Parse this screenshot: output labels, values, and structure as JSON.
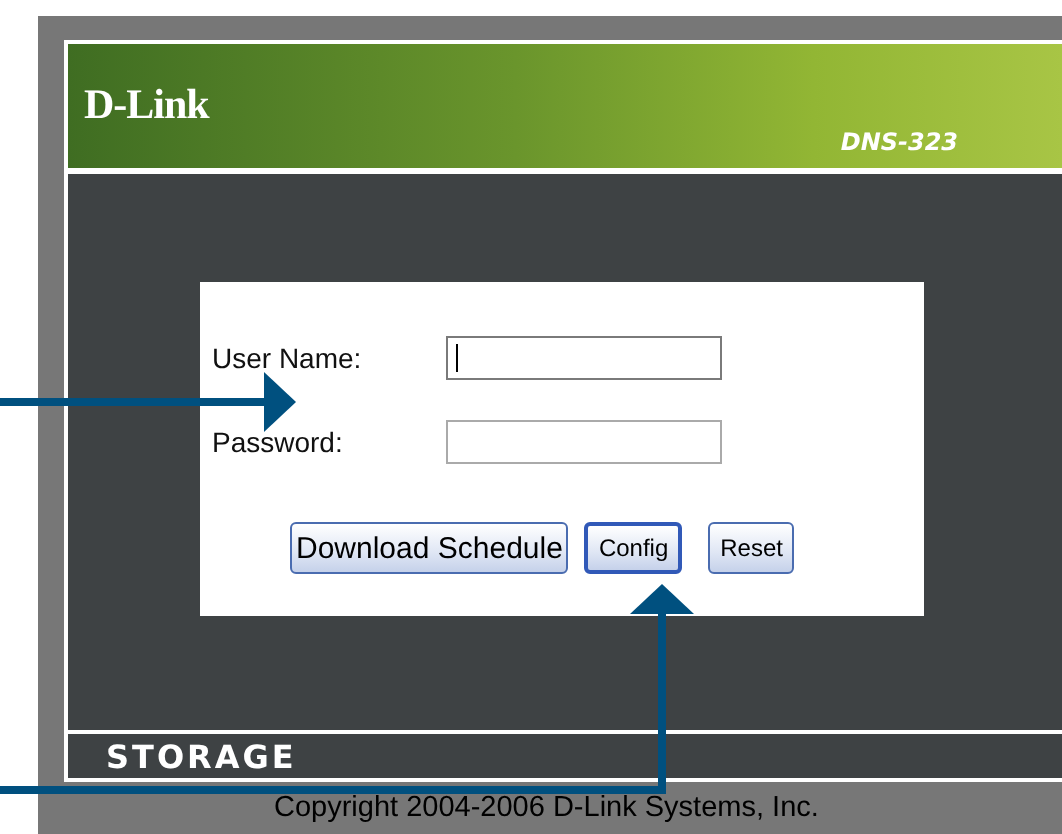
{
  "header": {
    "logo": "D-Link",
    "model": "DNS-323"
  },
  "login_form": {
    "fields": [
      {
        "label": "User Name:",
        "focused": true
      },
      {
        "label": "Password:",
        "focused": false
      }
    ],
    "buttons": [
      "Download Schedule",
      "Config",
      "Reset"
    ]
  },
  "footer": {
    "brand": "STORAGE",
    "copyright": "Copyright 2004-2006 D-Link Systems, Inc."
  }
}
